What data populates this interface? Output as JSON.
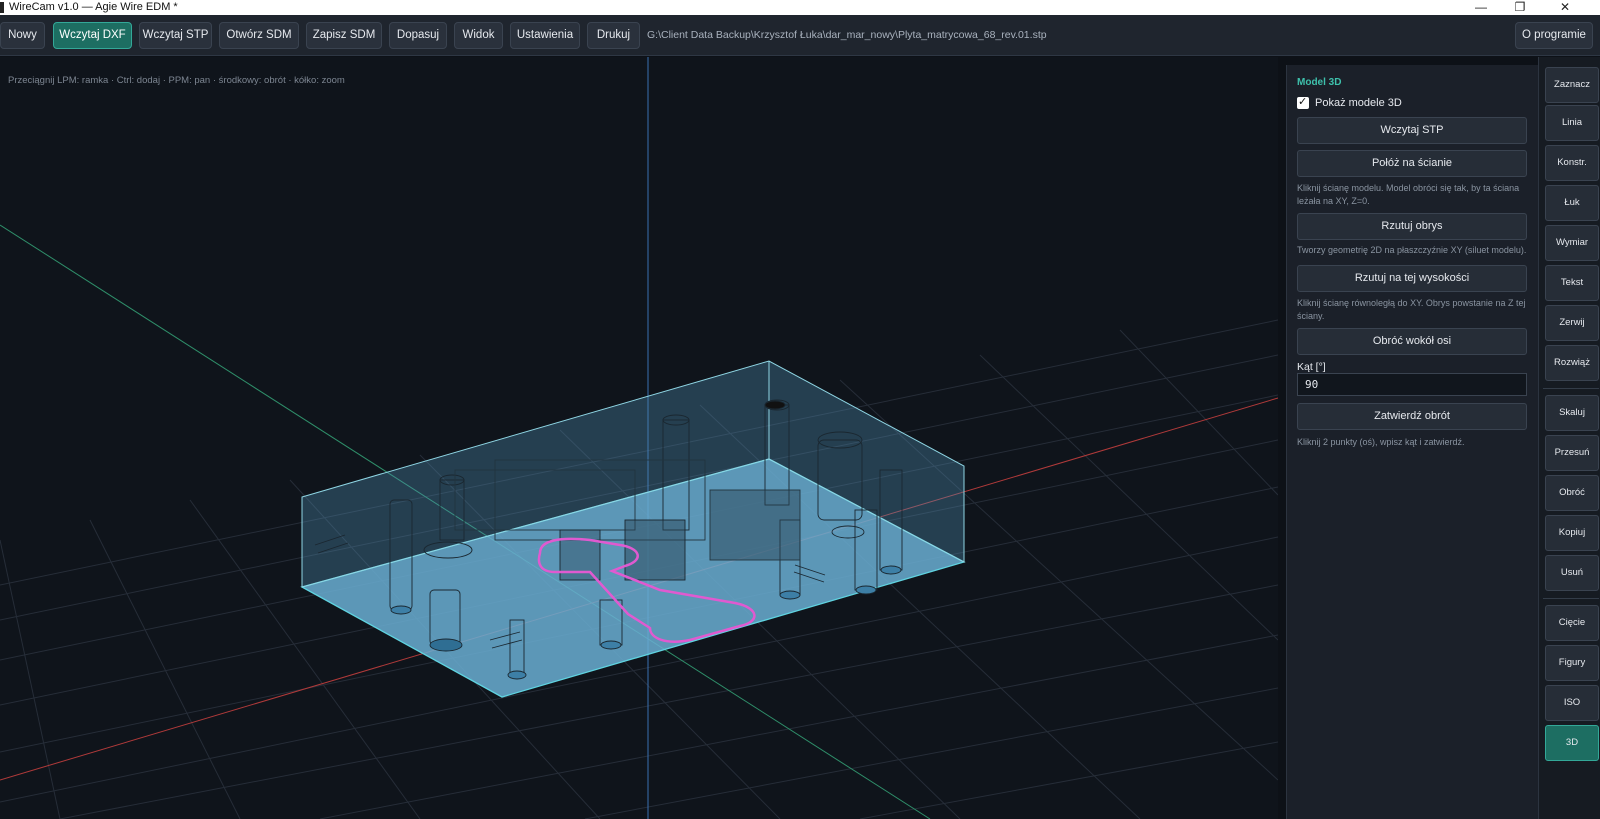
{
  "window": {
    "title": "WireCam v1.0 — Agie Wire EDM *",
    "minimize": "—",
    "maximize": "❐",
    "close": "✕"
  },
  "toolbar": {
    "buttons": [
      "Nowy",
      "Wczytaj DXF",
      "Wczytaj STP",
      "Otwórz SDM",
      "Zapisz SDM",
      "Dopasuj",
      "Widok",
      "Ustawienia",
      "Drukuj"
    ],
    "active": "Wczytaj DXF",
    "path": "G:\\Client Data Backup\\Krzysztof Łuka\\dar_mar_nowy\\Plyta_matrycowa_68_rev.01.stp",
    "about": "O programie"
  },
  "viewport": {
    "hint": "Przeciągnij LPM: ramka · Ctrl: dodaj · PPM: pan · środkowy: obrót · kółko: zoom"
  },
  "panel": {
    "title": "Model 3D",
    "show_models_label": "Pokaż modele 3D",
    "show_models_checked": true,
    "load_stp": "Wczytaj STP",
    "lay_on_face": "Połóż na ścianie",
    "lay_note": "Kliknij ścianę modelu. Model obróci się tak, by ta ściana leżała na XY, Z=0.",
    "project_outline": "Rzutuj obrys",
    "project_note": "Tworzy geometrię 2D na płaszczyźnie XY (siluet modelu).",
    "project_height": "Rzutuj na tej wysokości",
    "height_note": "Kliknij ścianę równoległą do XY. Obrys powstanie na Z tej ściany.",
    "rotate_axis": "Obróć wokół osi",
    "angle_label": "Kąt [°]",
    "angle_value": "90",
    "confirm_rotation": "Zatwierdź obrót",
    "rotation_note": "Kliknij 2 punkty (oś), wpisz kąt i zatwierdź."
  },
  "rightbar": {
    "tools": [
      "Zaznacz",
      "Linia",
      "Konstr.",
      "Łuk",
      "Wymiar",
      "Tekst",
      "Zerwij",
      "Rozwiąż"
    ],
    "transforms": [
      "Skaluj",
      "Przesuń",
      "Obróć",
      "Kopiuj",
      "Usuń"
    ],
    "modes": [
      "Cięcie",
      "Figury",
      "ISO",
      "3D"
    ],
    "active": "3D"
  },
  "colors": {
    "accent": "#1d6e62",
    "accent_text": "#3ec1ac",
    "model_fill": "#5ea3c8",
    "model_edge": "#5fd3e0",
    "contour": "#e05ad0",
    "axis_x": "#b03a3a",
    "axis_y": "#2f8f6a",
    "axis_z": "#3a6fb0"
  }
}
